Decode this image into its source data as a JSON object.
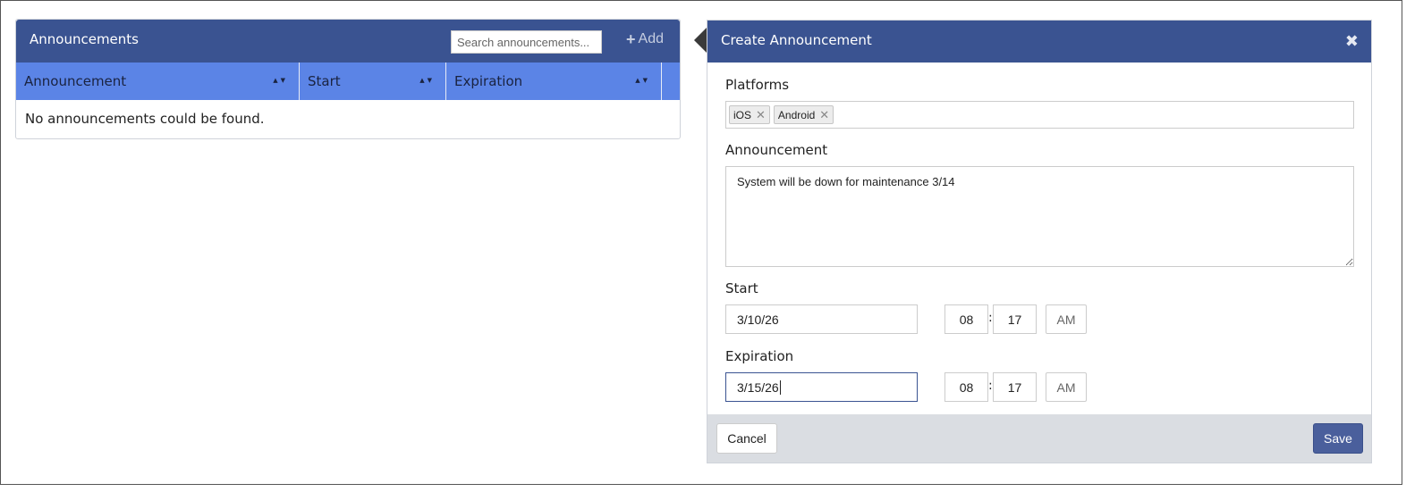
{
  "list": {
    "title": "Announcements",
    "search_placeholder": "Search announcements...",
    "add_label": "Add",
    "columns": [
      "Announcement",
      "Start",
      "Expiration"
    ],
    "empty_message": "No announcements could be found."
  },
  "form": {
    "title": "Create Announcement",
    "platforms_label": "Platforms",
    "platforms": [
      "iOS",
      "Android"
    ],
    "announcement_label": "Announcement",
    "announcement_value": "System will be down for maintenance 3/14",
    "start_label": "Start",
    "start": {
      "date": "3/10/26",
      "hour": "08",
      "minute": "17",
      "ampm": "AM"
    },
    "expiration_label": "Expiration",
    "expiration": {
      "date": "3/15/26",
      "hour": "08",
      "minute": "17",
      "ampm": "AM"
    },
    "time_separator": ":",
    "cancel_label": "Cancel",
    "save_label": "Save"
  },
  "colors": {
    "header_bg": "#3a5391",
    "table_head_bg": "#5b84e6",
    "footer_bg": "#dadde2",
    "save_bg": "#4a5f9c"
  },
  "icons": {
    "add": "plus-icon",
    "close": "close-icon",
    "sort": "sort-arrows-icon",
    "tag_remove": "remove-tag-icon"
  }
}
